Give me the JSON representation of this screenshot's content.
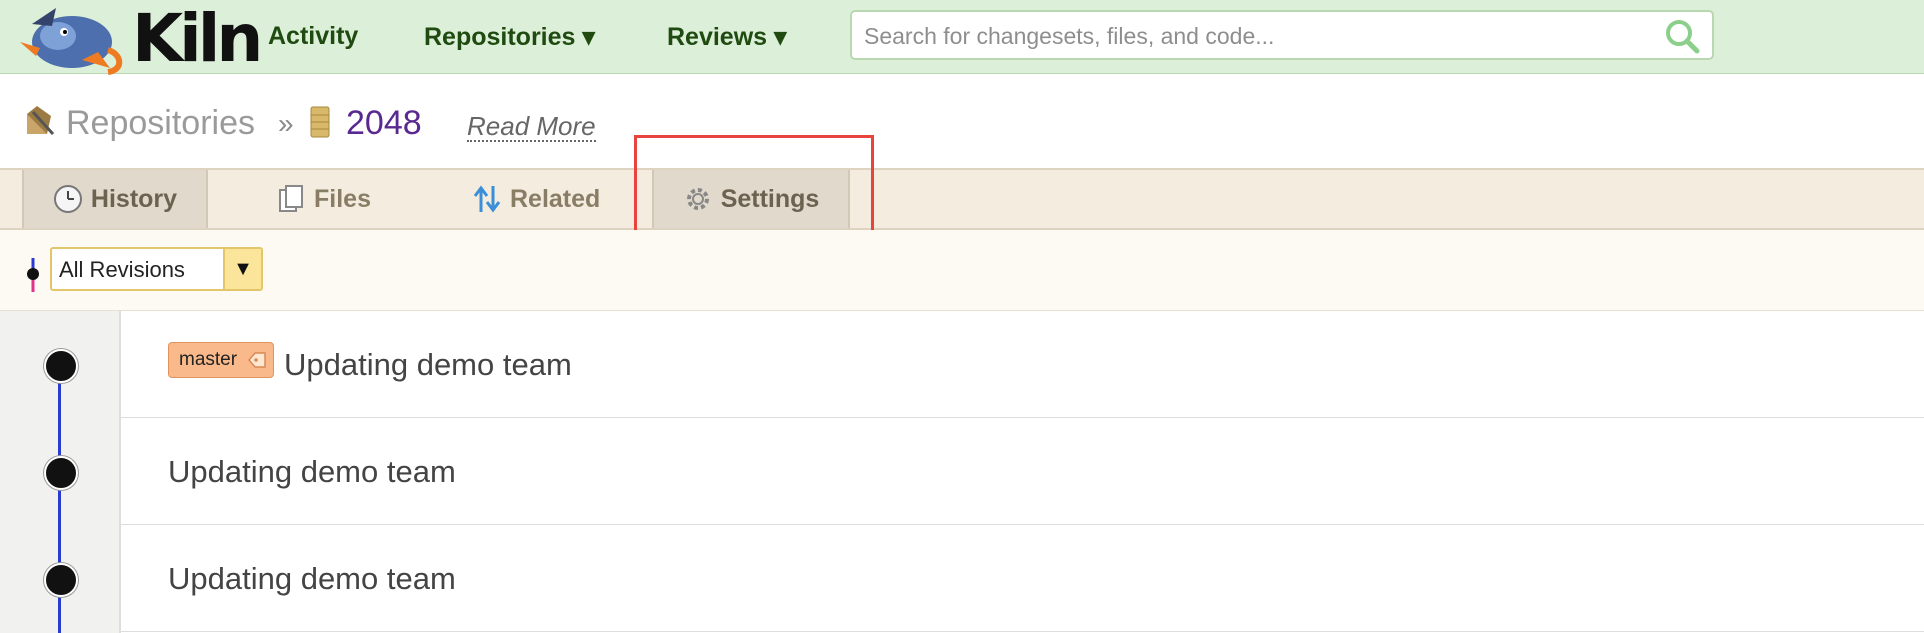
{
  "brand": {
    "name": "Kiln"
  },
  "nav": {
    "items": [
      {
        "label": "Activity"
      },
      {
        "label": "Repositories ▾"
      },
      {
        "label": "Reviews ▾"
      }
    ]
  },
  "search": {
    "placeholder": "Search for changesets, files, and code..."
  },
  "breadcrumb": {
    "root": "Repositories",
    "separator": "»",
    "repo": "2048",
    "read_more": "Read More"
  },
  "tabs": [
    {
      "label": "History",
      "icon": "clock-icon",
      "active": true
    },
    {
      "label": "Files",
      "icon": "files-icon",
      "active": false
    },
    {
      "label": "Related",
      "icon": "related-arrows-icon",
      "active": false
    },
    {
      "label": "Settings",
      "icon": "gear-icon",
      "active": false
    }
  ],
  "filter": {
    "selected": "All Revisions",
    "arrow": "▼"
  },
  "changesets": [
    {
      "title": "Updating demo team",
      "tag": "master"
    },
    {
      "title": "Updating demo team"
    },
    {
      "title": "Updating demo team"
    }
  ],
  "colors": {
    "topbar": "#dcefd8",
    "nav_text": "#1f4a10",
    "repo_link": "#5a2891",
    "highlight": "#e8443d",
    "graph_line": "#2b3ad0",
    "tag_bg": "#f9b98a"
  }
}
